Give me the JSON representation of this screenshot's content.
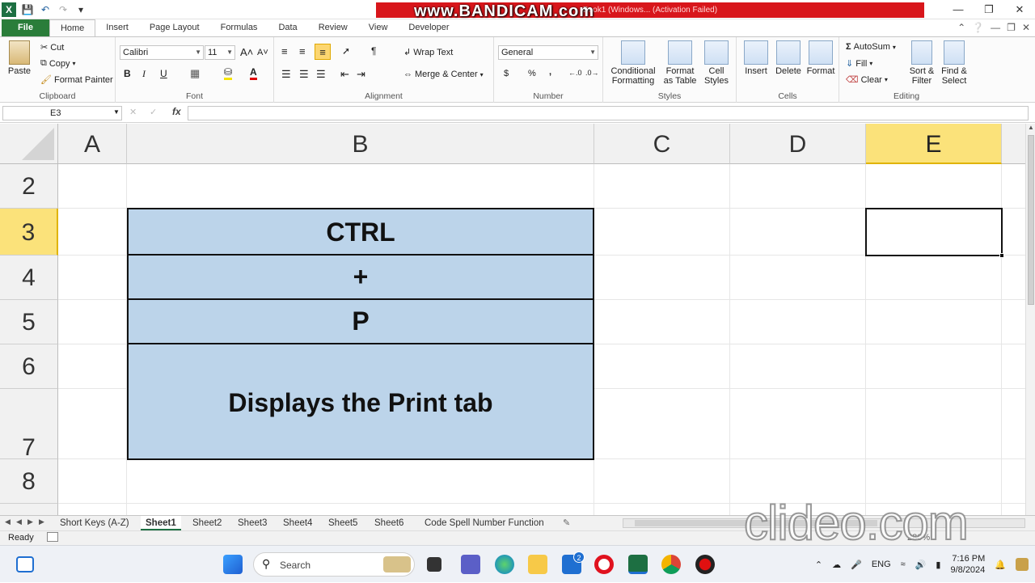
{
  "window": {
    "title": "Book1 (Windows... (Activation Failed)",
    "watermark": "www.BANDICAM.com",
    "controls": [
      "minimize",
      "restore",
      "close"
    ]
  },
  "ribbon_tabs": [
    "File",
    "Home",
    "Insert",
    "Page Layout",
    "Formulas",
    "Data",
    "Review",
    "View",
    "Developer"
  ],
  "active_tab": "Home",
  "clipboard": {
    "paste": "Paste",
    "cut": "Cut",
    "copy": "Copy",
    "format_painter": "Format Painter",
    "label": "Clipboard"
  },
  "font": {
    "name": "Calibri",
    "size": "11",
    "bold": "B",
    "italic": "I",
    "underline": "U",
    "label": "Font"
  },
  "alignment": {
    "wrap": "Wrap Text",
    "merge": "Merge & Center",
    "label": "Alignment"
  },
  "number": {
    "format": "General",
    "currency": "$",
    "percent": "%",
    "comma": ",",
    "label": "Number"
  },
  "styles": {
    "conditional": [
      "Conditional",
      "Formatting"
    ],
    "format_table": [
      "Format",
      "as Table"
    ],
    "cell_styles": [
      "Cell",
      "Styles"
    ],
    "label": "Styles"
  },
  "cells": {
    "insert": "Insert",
    "delete": "Delete",
    "format": "Format",
    "label": "Cells"
  },
  "editing": {
    "autosum": "AutoSum",
    "fill": "Fill",
    "clear": "Clear",
    "sort": [
      "Sort &",
      "Filter"
    ],
    "find": [
      "Find &",
      "Select"
    ],
    "label": "Editing"
  },
  "formula_bar": {
    "name_box": "E3",
    "fx": "fx",
    "content": ""
  },
  "columns": [
    "A",
    "B",
    "C",
    "D",
    "E"
  ],
  "selected_column": "E",
  "rows": [
    "2",
    "3",
    "4",
    "5",
    "6",
    "7",
    "8"
  ],
  "selected_row": "3",
  "cells_b": {
    "b3": "CTRL",
    "b4": "+",
    "b5": "P",
    "b6_7": "Displays the Print tab"
  },
  "sheet_tabs": [
    "Short Keys (A-Z)",
    "Sheet1",
    "Sheet2",
    "Sheet3",
    "Sheet4",
    "Sheet5",
    "Sheet6",
    "Code Spell Number Function"
  ],
  "active_sheet": "Sheet1",
  "status": {
    "ready": "Ready",
    "zoom": "280%",
    "watermark": "clideo.com"
  },
  "taskbar": {
    "search": "Search",
    "lang": "ENG",
    "time": "7:16 PM",
    "date": "9/8/2024",
    "badge": "2"
  }
}
